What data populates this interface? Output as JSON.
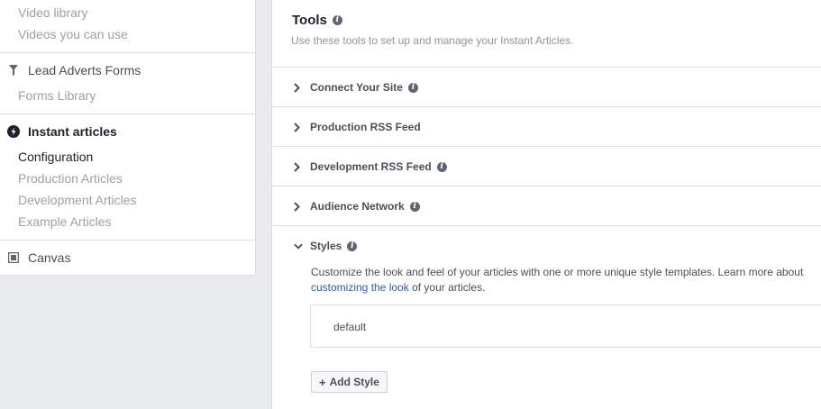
{
  "sidebar": {
    "video_library": "Video library",
    "videos_you_can_use": "Videos you can use",
    "lead_adverts_forms": "Lead Adverts Forms",
    "forms_library": "Forms Library",
    "instant_articles": "Instant articles",
    "configuration": "Configuration",
    "production_articles": "Production Articles",
    "development_articles": "Development Articles",
    "example_articles": "Example Articles",
    "canvas": "Canvas"
  },
  "tools": {
    "title": "Tools",
    "subtitle": "Use these tools to set up and manage your Instant Articles.",
    "sections": [
      {
        "label": "Connect Your Site"
      },
      {
        "label": "Production RSS Feed"
      },
      {
        "label": "Development RSS Feed"
      },
      {
        "label": "Audience Network"
      },
      {
        "label": "Styles"
      }
    ],
    "styles": {
      "description_before": "Customize the look and feel of your articles with one or more unique style templates. Learn more about ",
      "description_link": "customizing the look",
      "description_after": " of your articles.",
      "items": [
        "default"
      ],
      "add_button": "Add Style"
    }
  },
  "colors": {
    "link": "#365899",
    "text": "#1d2129",
    "muted": "#9ca0a6",
    "border": "#dddfe2"
  }
}
